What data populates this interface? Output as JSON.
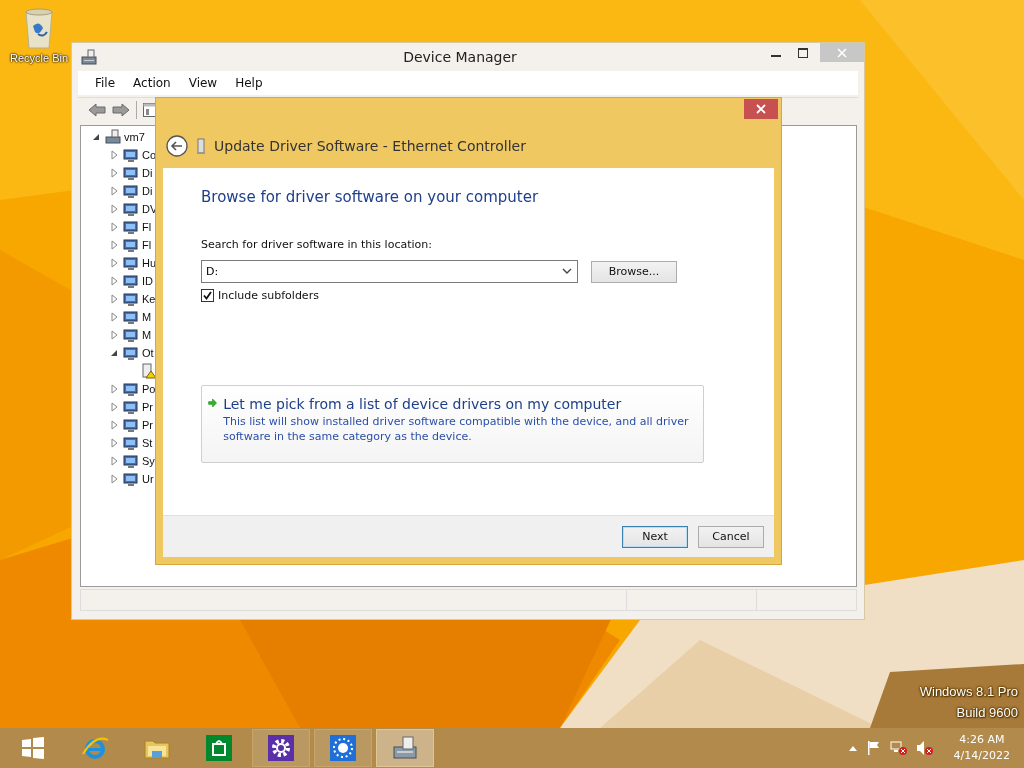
{
  "desktop": {
    "icons": [
      {
        "label": "Recycle Bin"
      }
    ],
    "watermark": [
      "Windows 8.1 Pro",
      "Build 9600"
    ]
  },
  "device_manager": {
    "title": "Device Manager",
    "menu": [
      "File",
      "Action",
      "View",
      "Help"
    ],
    "tree": [
      {
        "label": "vm7",
        "expanded": true,
        "children": [
          {
            "label": "Co",
            "expanded": false
          },
          {
            "label": "Di",
            "expanded": false
          },
          {
            "label": "Di",
            "expanded": false
          },
          {
            "label": "DV",
            "expanded": false
          },
          {
            "label": "Fl",
            "expanded": false
          },
          {
            "label": "Fl",
            "expanded": false
          },
          {
            "label": "Hu",
            "expanded": false
          },
          {
            "label": "ID",
            "expanded": false
          },
          {
            "label": "Ke",
            "expanded": false
          },
          {
            "label": "M",
            "expanded": false
          },
          {
            "label": "M",
            "expanded": false
          },
          {
            "label": "Ot",
            "expanded": true,
            "children": [
              {
                "kind": "warning"
              }
            ]
          },
          {
            "label": "Po",
            "expanded": false
          },
          {
            "label": "Pr",
            "expanded": false
          },
          {
            "label": "Pr",
            "expanded": false
          },
          {
            "label": "St",
            "expanded": false
          },
          {
            "label": "Sy",
            "expanded": false
          },
          {
            "label": "Ur",
            "expanded": false
          }
        ]
      }
    ]
  },
  "dialog": {
    "title": "Update Driver Software - Ethernet Controller",
    "heading": "Browse for driver software on your computer",
    "location_label": "Search for driver software in this location:",
    "location_value": "D:",
    "include_subfolders": {
      "label": "Include subfolders",
      "checked": true
    },
    "command_link": {
      "title": "Let me pick from a list of device drivers on my computer",
      "description": "This list will show installed driver software compatible with the device, and all driver software in the same category as the device."
    },
    "browse_button": "Browse...",
    "buttons": [
      {
        "label": "Next",
        "default": true
      },
      {
        "label": "Cancel",
        "default": false
      }
    ]
  },
  "taskbar": {
    "items": [
      {
        "kind": "start",
        "running": false,
        "selected": false
      },
      {
        "kind": "browser",
        "running": false,
        "selected": false
      },
      {
        "kind": "folder",
        "running": false,
        "selected": false
      },
      {
        "kind": "store",
        "running": false,
        "selected": false
      },
      {
        "kind": "settings",
        "running": true,
        "selected": false
      },
      {
        "kind": "brightness",
        "running": true,
        "selected": false
      },
      {
        "kind": "device-manager",
        "running": true,
        "selected": true
      }
    ],
    "time": "4:26 AM",
    "date": "4/14/2022"
  }
}
